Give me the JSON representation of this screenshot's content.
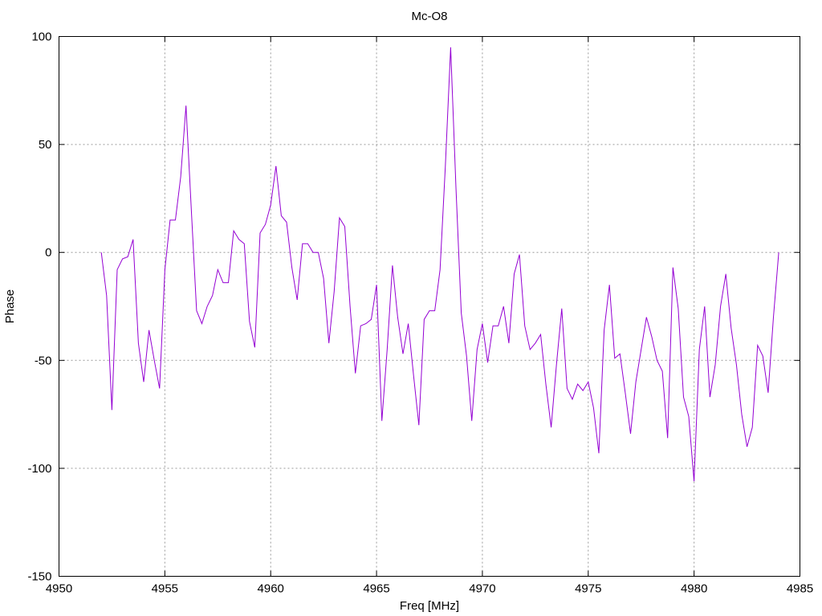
{
  "chart_data": {
    "type": "line",
    "title": "Mc-O8",
    "xlabel": "Freq [MHz]",
    "ylabel": "Phase",
    "xlim": [
      4950,
      4985
    ],
    "ylim": [
      -150,
      100
    ],
    "grid": true,
    "x_ticks": [
      4950,
      4955,
      4960,
      4965,
      4970,
      4975,
      4980,
      4985
    ],
    "y_ticks": [
      100,
      50,
      0,
      -50,
      -100,
      -150
    ],
    "series": [
      {
        "color": "#9400d3",
        "x": [
          4952.0,
          4952.25,
          4952.5,
          4952.75,
          4953.0,
          4953.25,
          4953.5,
          4953.75,
          4954.0,
          4954.25,
          4954.5,
          4954.75,
          4955.0,
          4955.25,
          4955.5,
          4955.75,
          4956.0,
          4956.25,
          4956.5,
          4956.75,
          4957.0,
          4957.25,
          4957.5,
          4957.75,
          4958.0,
          4958.25,
          4958.5,
          4958.75,
          4959.0,
          4959.25,
          4959.5,
          4959.75,
          4960.0,
          4960.25,
          4960.5,
          4960.75,
          4961.0,
          4961.25,
          4961.5,
          4961.75,
          4962.0,
          4962.25,
          4962.5,
          4962.75,
          4963.0,
          4963.25,
          4963.5,
          4963.75,
          4964.0,
          4964.25,
          4964.5,
          4964.75,
          4965.0,
          4965.25,
          4965.5,
          4965.75,
          4966.0,
          4966.25,
          4966.5,
          4966.75,
          4967.0,
          4967.25,
          4967.5,
          4967.75,
          4968.0,
          4968.25,
          4968.5,
          4968.75,
          4969.0,
          4969.25,
          4969.5,
          4969.75,
          4970.0,
          4970.25,
          4970.5,
          4970.75,
          4971.0,
          4971.25,
          4971.5,
          4971.75,
          4972.0,
          4972.25,
          4972.5,
          4972.75,
          4973.0,
          4973.25,
          4973.5,
          4973.75,
          4974.0,
          4974.25,
          4974.5,
          4974.75,
          4975.0,
          4975.25,
          4975.5,
          4975.75,
          4976.0,
          4976.25,
          4976.5,
          4976.75,
          4977.0,
          4977.25,
          4977.5,
          4977.75,
          4978.0,
          4978.25,
          4978.5,
          4978.75,
          4979.0,
          4979.25,
          4979.5,
          4979.75,
          4980.0,
          4980.25,
          4980.5,
          4980.75,
          4981.0,
          4981.25,
          4981.5,
          4981.75,
          4982.0,
          4982.25,
          4982.5,
          4982.75,
          4983.0,
          4983.25,
          4983.5,
          4983.75,
          4984.0
        ],
        "y": [
          0,
          -20,
          -73,
          -8,
          -3,
          -2,
          6,
          -42,
          -60,
          -36,
          -50,
          -63,
          -8,
          15,
          15,
          35,
          68,
          20,
          -27,
          -33,
          -25,
          -20,
          -8,
          -14,
          -14,
          10,
          6,
          4,
          -32,
          -44,
          9,
          13,
          22,
          40,
          17,
          14,
          -7,
          -22,
          4,
          4,
          0,
          0,
          -12,
          -42,
          -18,
          16,
          12,
          -25,
          -56,
          -34,
          -33,
          -31,
          -15,
          -78,
          -45,
          -6,
          -30,
          -47,
          -33,
          -57,
          -80,
          -31,
          -27,
          -27,
          -8,
          40,
          95,
          30,
          -28,
          -48,
          -78,
          -45,
          -33,
          -51,
          -34,
          -34,
          -25,
          -42,
          -10,
          -1,
          -34,
          -45,
          -42,
          -38,
          -61,
          -81,
          -52,
          -26,
          -63,
          -68,
          -61,
          -64,
          -60,
          -72,
          -93,
          -36,
          -15,
          -49,
          -47,
          -65,
          -84,
          -60,
          -45,
          -30,
          -39,
          -50,
          -55,
          -86,
          -7,
          -26,
          -67,
          -76,
          -106,
          -45,
          -25,
          -67,
          -52,
          -25,
          -10,
          -35,
          -52,
          -75,
          -90,
          -81,
          -43,
          -48,
          -65,
          -30,
          0
        ]
      }
    ]
  }
}
